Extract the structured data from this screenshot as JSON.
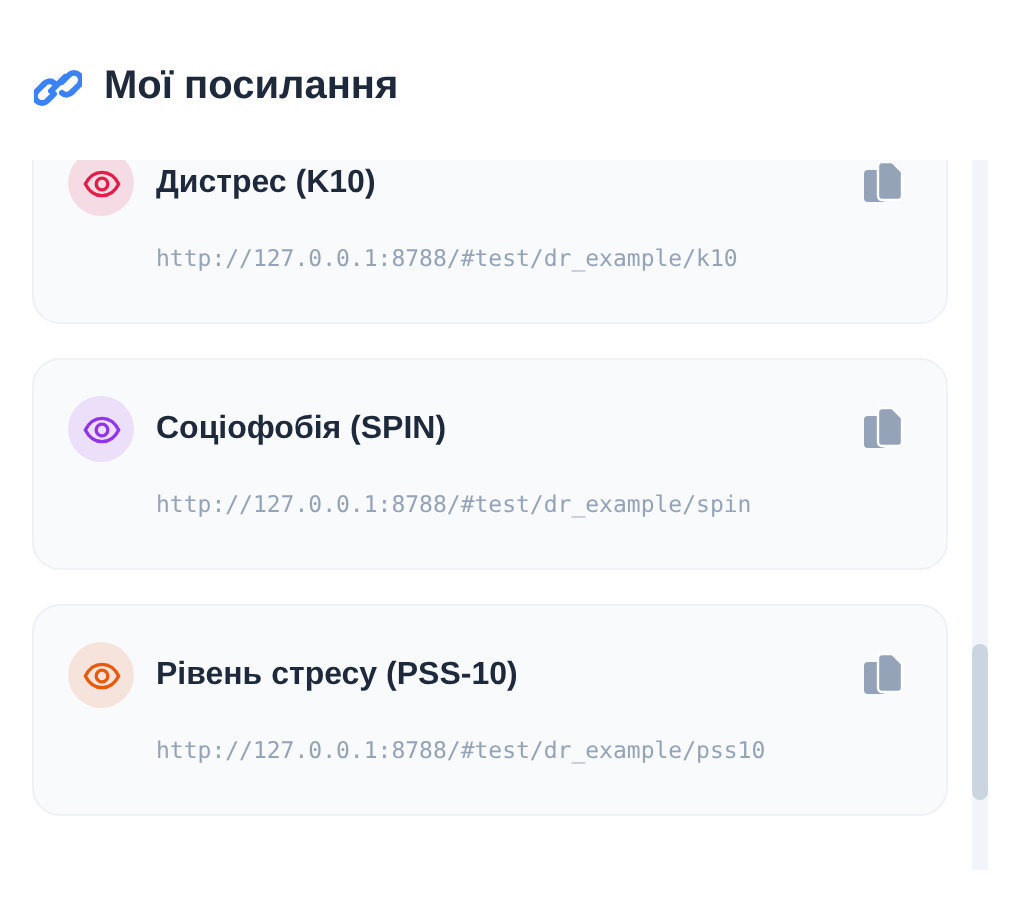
{
  "title": "Мої посилання",
  "links": [
    {
      "name": "Дистрес (K10)",
      "url": "http://127.0.0.1:8788/#test/dr_example/k10",
      "color": "#e11d48"
    },
    {
      "name": "Соціофобія (SPIN)",
      "url": "http://127.0.0.1:8788/#test/dr_example/spin",
      "color": "#9333ea"
    },
    {
      "name": "Рівень стресу (PSS-10)",
      "url": "http://127.0.0.1:8788/#test/dr_example/pss10",
      "color": "#ea580c"
    }
  ]
}
